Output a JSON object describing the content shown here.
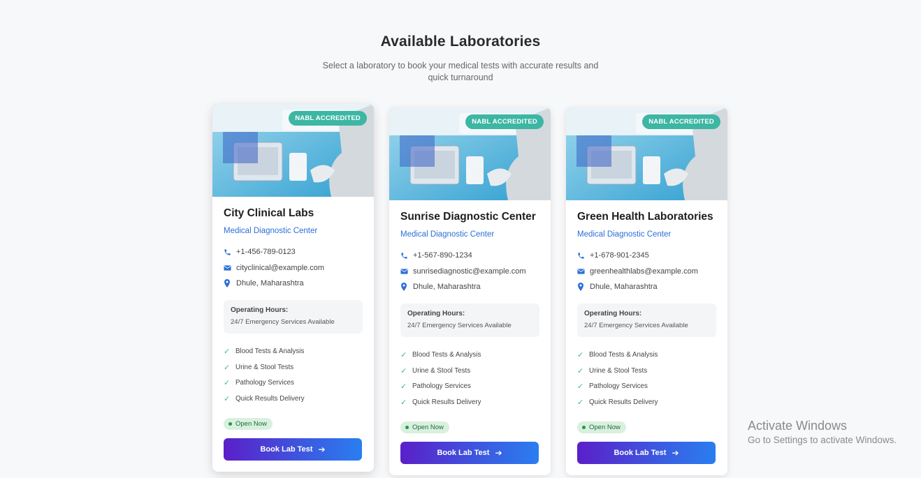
{
  "header": {
    "title": "Available Laboratories",
    "subtitle": "Select a laboratory to book your medical tests with accurate results and quick turnaround"
  },
  "labs": [
    {
      "badge": "NABL ACCREDITED",
      "name": "City Clinical Labs",
      "type": "Medical Diagnostic Center",
      "phone": "+1-456-789-0123",
      "email": "cityclinical@example.com",
      "location": "Dhule, Maharashtra",
      "hours_label": "Operating Hours:",
      "hours_value": "24/7 Emergency Services Available",
      "features": [
        "Blood Tests & Analysis",
        "Urine & Stool Tests",
        "Pathology Services",
        "Quick Results Delivery"
      ],
      "status": "Open Now",
      "button": "Book Lab Test"
    },
    {
      "badge": "NABL ACCREDITED",
      "name": "Sunrise Diagnostic Center",
      "type": "Medical Diagnostic Center",
      "phone": "+1-567-890-1234",
      "email": "sunrisediagnostic@example.com",
      "location": "Dhule, Maharashtra",
      "hours_label": "Operating Hours:",
      "hours_value": "24/7 Emergency Services Available",
      "features": [
        "Blood Tests & Analysis",
        "Urine & Stool Tests",
        "Pathology Services",
        "Quick Results Delivery"
      ],
      "status": "Open Now",
      "button": "Book Lab Test"
    },
    {
      "badge": "NABL ACCREDITED",
      "name": "Green Health Laboratories",
      "type": "Medical Diagnostic Center",
      "phone": "+1-678-901-2345",
      "email": "greenhealthlabs@example.com",
      "location": "Dhule, Maharashtra",
      "hours_label": "Operating Hours:",
      "hours_value": "24/7 Emergency Services Available",
      "features": [
        "Blood Tests & Analysis",
        "Urine & Stool Tests",
        "Pathology Services",
        "Quick Results Delivery"
      ],
      "status": "Open Now",
      "button": "Book Lab Test"
    }
  ],
  "icons": {
    "phone": "phone-icon",
    "email": "envelope-icon",
    "location": "map-pin-icon",
    "check": "checkmark-icon",
    "arrow": "arrow-right-icon"
  },
  "colors": {
    "accent_blue": "#2a6fd8",
    "badge_teal": "#3db6a4",
    "button_gradient_start": "#5b1fc9",
    "button_gradient_end": "#2a7ef0",
    "status_bg": "#d9f0df"
  },
  "watermark": {
    "title": "Activate Windows",
    "subtitle": "Go to Settings to activate Windows."
  }
}
